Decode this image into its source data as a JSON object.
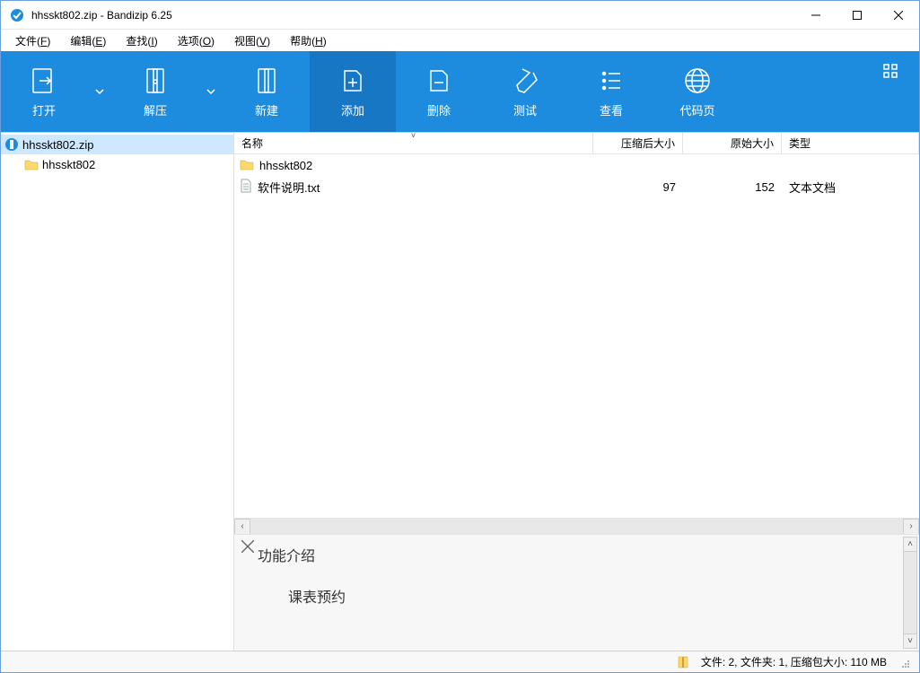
{
  "titlebar": {
    "title": "hhsskt802.zip - Bandizip 6.25"
  },
  "menu": {
    "file": "文件(",
    "file_u": "F",
    "file_end": ")",
    "edit": "编辑(",
    "edit_u": "E",
    "edit_end": ")",
    "find": "查找(",
    "find_u": "I",
    "find_end": ")",
    "options": "选项(",
    "options_u": "O",
    "options_end": ")",
    "view": "视图(",
    "view_u": "V",
    "view_end": ")",
    "help": "帮助(",
    "help_u": "H",
    "help_end": ")"
  },
  "toolbar": {
    "open": "打开",
    "extract": "解压",
    "new": "新建",
    "add": "添加",
    "delete": "删除",
    "test": "测试",
    "view": "查看",
    "codepage": "代码页"
  },
  "tree": {
    "root": "hhsskt802.zip",
    "child": "hhsskt802"
  },
  "columns": {
    "name": "名称",
    "compressed": "压缩后大小",
    "original": "原始大小",
    "type": "类型"
  },
  "rows": [
    {
      "name": "hhsskt802",
      "compressed": "",
      "original": "",
      "type": "",
      "kind": "folder"
    },
    {
      "name": "软件说明.txt",
      "compressed": "97",
      "original": "152",
      "type": "文本文档",
      "kind": "txt"
    }
  ],
  "info": {
    "title": "功能介绍",
    "sub": "课表预约"
  },
  "status": {
    "text": "文件: 2, 文件夹: 1, 压缩包大小: 110 MB"
  }
}
